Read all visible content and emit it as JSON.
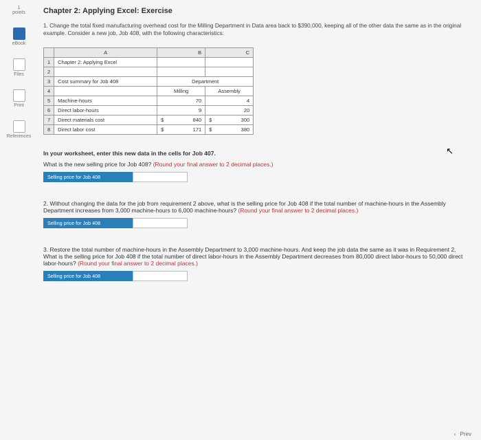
{
  "sidebar": {
    "points_label": "points",
    "points_value": "1",
    "items": [
      {
        "label": "eBook"
      },
      {
        "label": "Files"
      },
      {
        "label": "Print"
      },
      {
        "label": "References"
      }
    ]
  },
  "title": "Chapter 2: Applying Excel: Exercise",
  "q1": {
    "num": "1.",
    "text_a": "Change the total fixed manufacturing overhead cost for the Milling Department in Data area back to $390,000, keeping all of the other data the same as in the original example. Consider a new job, Job 408, with the following characteristics:"
  },
  "table": {
    "cols": [
      "A",
      "B",
      "C"
    ],
    "r1": "Chapter 2: Applying Excel",
    "r3": "Cost summary for Job 408",
    "dept": "Department",
    "milling": "Milling",
    "assembly": "Assembly",
    "r5_label": "Machine-hours",
    "r5_b": "70",
    "r5_c": "4",
    "r6_label": "Direct labor-hours",
    "r6_b": "9",
    "r6_c": "20",
    "r7_label": "Direct materials cost",
    "r7_b": "840",
    "r7_c": "300",
    "r8_label": "Direct labor cost",
    "r8_b": "171",
    "r8_c": "380",
    "dollar": "$"
  },
  "worksheet_instr": "In your worksheet, enter this new data in the cells for Job 407.",
  "q1b": {
    "text": "What is the new selling price for Job 408? ",
    "hint": "(Round your final answer to 2 decimal places.)",
    "label": "Selling price for Job 408"
  },
  "q2": {
    "num": "2.",
    "text": "Without changing the data for the job from requirement 2 above, what is the selling price for Job 408 if the total number of machine-hours in the Assembly Department increases from 3,000 machine-hours to 6,000 machine-hours? ",
    "hint": "(Round your final answer to 2 decimal places.)",
    "label": "Selling price for Job 408"
  },
  "q3": {
    "num": "3.",
    "text": "Restore the total number of machine-hours in the Assembly Department to 3,000 machine-hours. And keep the job data the same as it was in Requirement 2. What is the selling price for Job 408 if the total number of direct labor-hours in the Assembly Department decreases from 80,000 direct labor-hours to 50,000 direct labor-hours? ",
    "hint": "(Round your final answer to 2 decimal places.)",
    "label": "Selling price for Job 408"
  },
  "footer": {
    "prev": "Prev",
    "chev": "‹"
  }
}
